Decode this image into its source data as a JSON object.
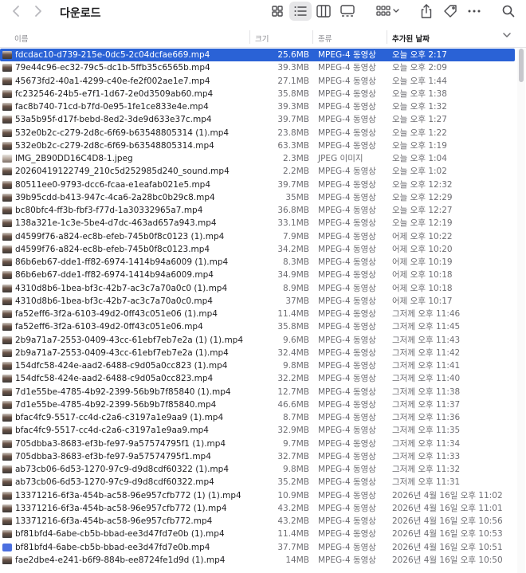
{
  "window": {
    "title": "다운로드"
  },
  "columns": {
    "name": "이름",
    "size": "크기",
    "kind": "종류",
    "date": "추가된 날짜"
  },
  "colors": {
    "selection": "#2a62d6",
    "header_text": "#8e8e93"
  },
  "icons": [
    "back-chevron-icon",
    "forward-chevron-icon",
    "icon-view-icon",
    "list-view-icon",
    "column-view-icon",
    "gallery-view-icon",
    "group-by-icon",
    "share-icon",
    "tag-icon",
    "more-icon",
    "search-icon"
  ],
  "files": [
    {
      "name": "fdcdac10-d739-215e-0dc5-2c04dcfae669.mp4",
      "size": "25.6MB",
      "kind": "MPEG-4 동영상",
      "date": "오늘 오후 2:17",
      "selected": true,
      "thumb": "video"
    },
    {
      "name": "79e44c96-ec32-79c5-dc1b-5ffb35c6565b.mp4",
      "size": "39.3MB",
      "kind": "MPEG-4 동영상",
      "date": "오늘 오후 2:09",
      "thumb": "video"
    },
    {
      "name": "45673fd2-40a1-4299-c40e-fe2f002ae1e7.mp4",
      "size": "27.1MB",
      "kind": "MPEG-4 동영상",
      "date": "오늘 오후 1:44",
      "thumb": "video"
    },
    {
      "name": "fc232546-24b5-e7f1-1d67-2e0d3509ab60.mp4",
      "size": "35.8MB",
      "kind": "MPEG-4 동영상",
      "date": "오늘 오후 1:38",
      "thumb": "video"
    },
    {
      "name": "fac8b740-71cd-b7fd-0e95-1fe1ce833e4e.mp4",
      "size": "39.3MB",
      "kind": "MPEG-4 동영상",
      "date": "오늘 오후 1:32",
      "thumb": "video"
    },
    {
      "name": "53a5b95f-d17f-bebd-8ed2-3de9d633e37c.mp4",
      "size": "39.7MB",
      "kind": "MPEG-4 동영상",
      "date": "오늘 오후 1:27",
      "thumb": "video"
    },
    {
      "name": "532e0b2c-c279-2d8c-6f69-b63548805314 (1).mp4",
      "size": "23.8MB",
      "kind": "MPEG-4 동영상",
      "date": "오늘 오후 1:22",
      "thumb": "video"
    },
    {
      "name": "532e0b2c-c279-2d8c-6f69-b63548805314.mp4",
      "size": "63.3MB",
      "kind": "MPEG-4 동영상",
      "date": "오늘 오후 1:19",
      "thumb": "video"
    },
    {
      "name": "IMG_2B90DD16C4D8-1.jpeg",
      "size": "2.3MB",
      "kind": "JPEG 이미지",
      "date": "오늘 오후 1:04",
      "thumb": "img"
    },
    {
      "name": "20260419122749_210c5d252985d240_sound.mp4",
      "size": "2.2MB",
      "kind": "MPEG-4 동영상",
      "date": "오늘 오후 1:02",
      "thumb": "video"
    },
    {
      "name": "80511ee0-9793-dcc6-fcaa-e1eafab021e5.mp4",
      "size": "39.7MB",
      "kind": "MPEG-4 동영상",
      "date": "오늘 오후 12:32",
      "thumb": "video"
    },
    {
      "name": "39b95cdd-b413-947c-4ca6-2a28bc0b29c8.mp4",
      "size": "35MB",
      "kind": "MPEG-4 동영상",
      "date": "오늘 오후 12:29",
      "thumb": "video"
    },
    {
      "name": "bc80bfc4-ff3b-fbf3-f77d-1a30332965a7.mp4",
      "size": "36.8MB",
      "kind": "MPEG-4 동영상",
      "date": "오늘 오후 12:27",
      "thumb": "video"
    },
    {
      "name": "138a321e-1c3e-5be4-d7dc-463ad657a943.mp4",
      "size": "33.1MB",
      "kind": "MPEG-4 동영상",
      "date": "오늘 오후 12:19",
      "thumb": "video"
    },
    {
      "name": "d4599f76-a824-ec8b-efeb-745b0f8c0123 (1).mp4",
      "size": "7.9MB",
      "kind": "MPEG-4 동영상",
      "date": "어제 오후 10:22",
      "thumb": "video"
    },
    {
      "name": "d4599f76-a824-ec8b-efeb-745b0f8c0123.mp4",
      "size": "34.2MB",
      "kind": "MPEG-4 동영상",
      "date": "어제 오후 10:20",
      "thumb": "video"
    },
    {
      "name": "86b6eb67-dde1-ff82-6974-1414b94a6009 (1).mp4",
      "size": "8.3MB",
      "kind": "MPEG-4 동영상",
      "date": "어제 오후 10:19",
      "thumb": "video"
    },
    {
      "name": "86b6eb67-dde1-ff82-6974-1414b94a6009.mp4",
      "size": "34.9MB",
      "kind": "MPEG-4 동영상",
      "date": "어제 오후 10:18",
      "thumb": "video"
    },
    {
      "name": "4310d8b6-1bea-bf3c-42b7-ac3c7a70a0c0 (1).mp4",
      "size": "8.9MB",
      "kind": "MPEG-4 동영상",
      "date": "어제 오후 10:18",
      "thumb": "video"
    },
    {
      "name": "4310d8b6-1bea-bf3c-42b7-ac3c7a70a0c0.mp4",
      "size": "37MB",
      "kind": "MPEG-4 동영상",
      "date": "어제 오후 10:17",
      "thumb": "video"
    },
    {
      "name": "fa52eff6-3f2a-6103-49d2-0ff43c051e06 (1).mp4",
      "size": "11.4MB",
      "kind": "MPEG-4 동영상",
      "date": "그저께 오후 11:46",
      "thumb": "video"
    },
    {
      "name": "fa52eff6-3f2a-6103-49d2-0ff43c051e06.mp4",
      "size": "35.8MB",
      "kind": "MPEG-4 동영상",
      "date": "그저께 오후 11:45",
      "thumb": "video"
    },
    {
      "name": "2b9a71a7-2553-0409-43cc-61ebf7eb7e2a (1) (1).mp4",
      "size": "9.6MB",
      "kind": "MPEG-4 동영상",
      "date": "그저께 오후 11:43",
      "thumb": "video"
    },
    {
      "name": "2b9a71a7-2553-0409-43cc-61ebf7eb7e2a (1).mp4",
      "size": "32.4MB",
      "kind": "MPEG-4 동영상",
      "date": "그저께 오후 11:42",
      "thumb": "video"
    },
    {
      "name": "154dfc58-424e-aad2-6488-c9d05a0cc823 (1).mp4",
      "size": "9.8MB",
      "kind": "MPEG-4 동영상",
      "date": "그저께 오후 11:41",
      "thumb": "video"
    },
    {
      "name": "154dfc58-424e-aad2-6488-c9d05a0cc823.mp4",
      "size": "32.2MB",
      "kind": "MPEG-4 동영상",
      "date": "그저께 오후 11:40",
      "thumb": "video"
    },
    {
      "name": "7d1e55be-4785-4b92-2399-56b9b7f85840 (1).mp4",
      "size": "12.7MB",
      "kind": "MPEG-4 동영상",
      "date": "그저께 오후 11:38",
      "thumb": "video"
    },
    {
      "name": "7d1e55be-4785-4b92-2399-56b9b7f85840.mp4",
      "size": "46.6MB",
      "kind": "MPEG-4 동영상",
      "date": "그저께 오후 11:37",
      "thumb": "video"
    },
    {
      "name": "bfac4fc9-5517-cc4d-c2a6-c3197a1e9aa9 (1).mp4",
      "size": "8.7MB",
      "kind": "MPEG-4 동영상",
      "date": "그저께 오후 11:36",
      "thumb": "video"
    },
    {
      "name": "bfac4fc9-5517-cc4d-c2a6-c3197a1e9aa9.mp4",
      "size": "32.9MB",
      "kind": "MPEG-4 동영상",
      "date": "그저께 오후 11:35",
      "thumb": "video"
    },
    {
      "name": "705dbba3-8683-ef3b-fe97-9a57574795f1 (1).mp4",
      "size": "9.7MB",
      "kind": "MPEG-4 동영상",
      "date": "그저께 오후 11:34",
      "thumb": "video"
    },
    {
      "name": "705dbba3-8683-ef3b-fe97-9a57574795f1.mp4",
      "size": "32.7MB",
      "kind": "MPEG-4 동영상",
      "date": "그저께 오후 11:33",
      "thumb": "video"
    },
    {
      "name": "ab73cb06-6d53-1270-97c9-d9d8cdf60322 (1).mp4",
      "size": "9.8MB",
      "kind": "MPEG-4 동영상",
      "date": "그저께 오후 11:32",
      "thumb": "video"
    },
    {
      "name": "ab73cb06-6d53-1270-97c9-d9d8cdf60322.mp4",
      "size": "35.2MB",
      "kind": "MPEG-4 동영상",
      "date": "그저께 오후 11:31",
      "thumb": "video"
    },
    {
      "name": "13371216-6f3a-454b-ac58-96e957cfb772 (1) (1).mp4",
      "size": "10.9MB",
      "kind": "MPEG-4 동영상",
      "date": "2026년 4월 16일 오후 11:02",
      "thumb": "video"
    },
    {
      "name": "13371216-6f3a-454b-ac58-96e957cfb772 (1).mp4",
      "size": "43.2MB",
      "kind": "MPEG-4 동영상",
      "date": "2026년 4월 16일 오후 11:01",
      "thumb": "video"
    },
    {
      "name": "13371216-6f3a-454b-ac58-96e957cfb772.mp4",
      "size": "43.2MB",
      "kind": "MPEG-4 동영상",
      "date": "2026년 4월 16일 오후 10:56",
      "thumb": "video"
    },
    {
      "name": "bf81bfd4-6abe-cb5b-bbad-ee3d47fd7e0b (1).mp4",
      "size": "11.4MB",
      "kind": "MPEG-4 동영상",
      "date": "2026년 4월 16일 오후 10:53",
      "thumb": "video"
    },
    {
      "name": "bf81bfd4-6abe-cb5b-bbad-ee3d47fd7e0b.mp4",
      "size": "37.7MB",
      "kind": "MPEG-4 동영상",
      "date": "2026년 4월 16일 오후 10:51",
      "thumb": "mp4"
    },
    {
      "name": "fae2dbe4-e241-b6f9-884b-ee8724fe1d9d (1).mp4",
      "size": "14MB",
      "kind": "MPEG-4 동영상",
      "date": "2026년 4월 16일 오후 10:50",
      "thumb": "video"
    }
  ]
}
